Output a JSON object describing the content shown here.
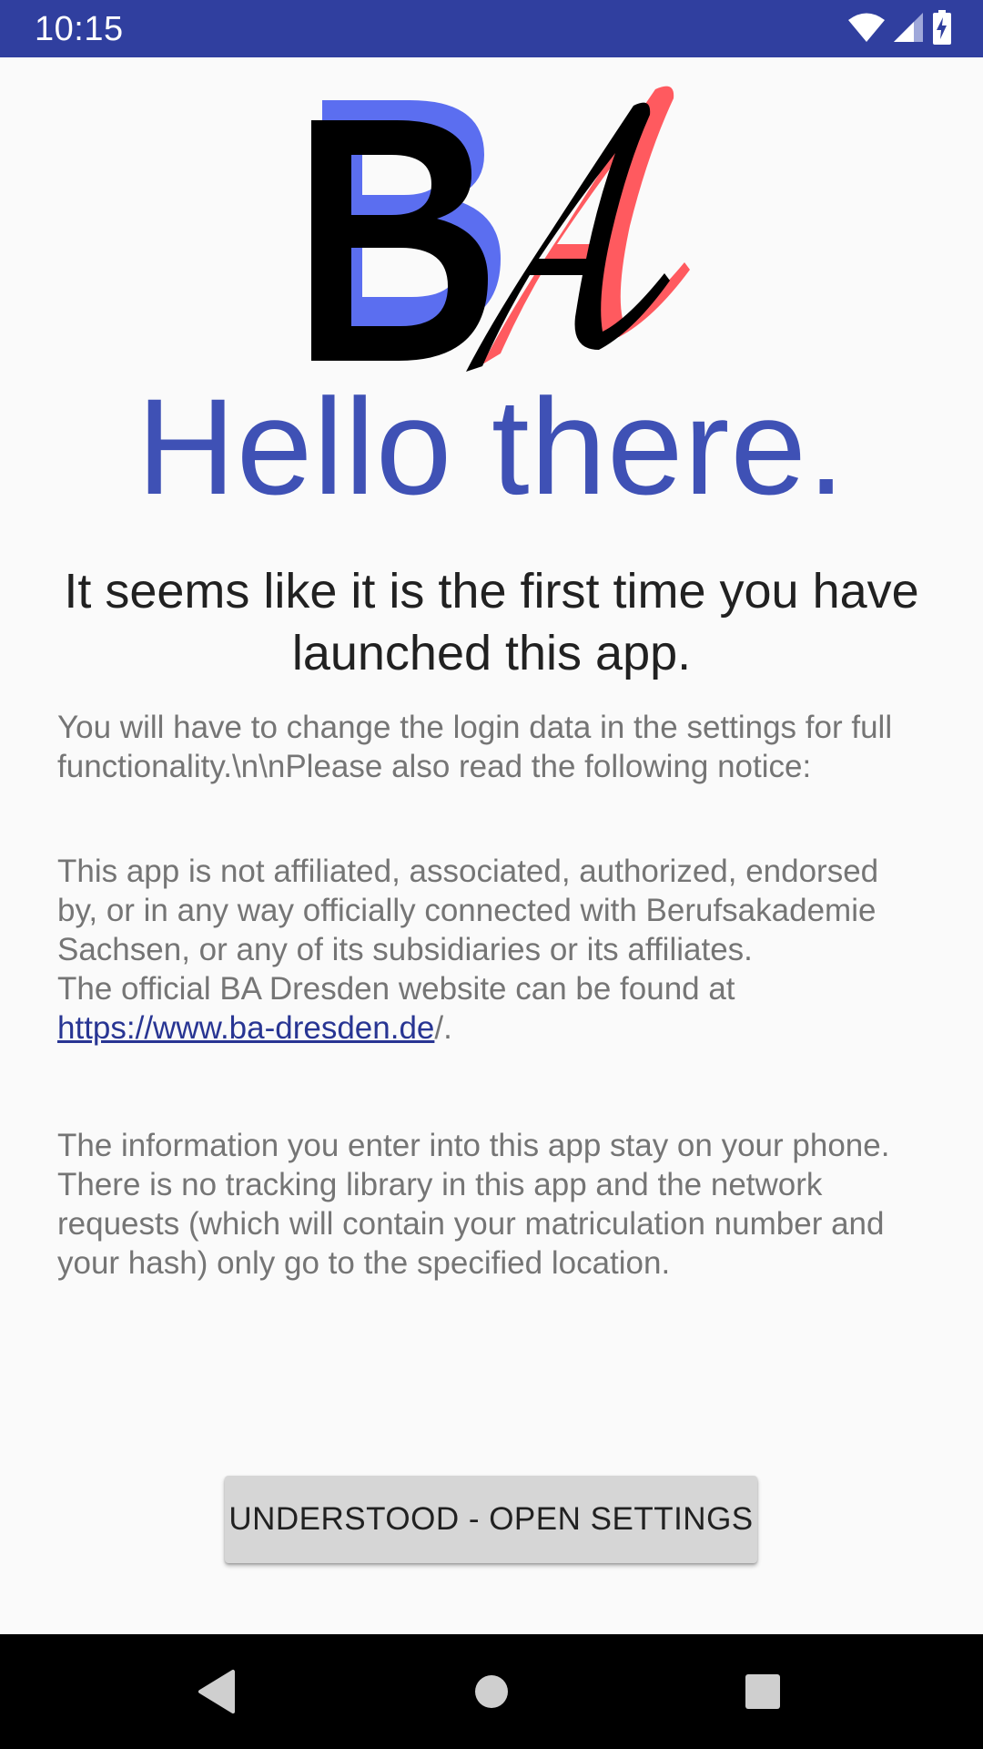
{
  "status_bar": {
    "time": "10:15",
    "icons": [
      "wifi-icon",
      "cell-signal-icon",
      "battery-charging-icon"
    ],
    "background": "#303f9f"
  },
  "logo": {
    "letters": "BA",
    "colors": {
      "blue": "#5b6ef0",
      "red": "#ff5a5f",
      "black": "#000000"
    }
  },
  "main": {
    "title": "Hello there.",
    "subtitle": "It seems like it is the first time you have launched this app.",
    "intro": "You will have to change the login data in the settings for full functionality.\\n\\nPlease also read the following notice:",
    "disclaimer": "This app is not affiliated, associated, authorized, endorsed by, or in any way officially connected with Berufsakademie Sachsen, or any of its subsidiaries or its affiliates.",
    "website_prefix": "The official BA Dresden website can be found at",
    "website_link": "https://www.ba-dresden.de",
    "website_suffix": "/.",
    "privacy": "The information you enter into this app stay on your phone. There is no tracking library in this app and the network requests (which will contain your matriculation number and your hash) only go to the specified location."
  },
  "actions": {
    "open_settings_label": "UNDERSTOOD - OPEN SETTINGS"
  },
  "nav_bar": {
    "icons": [
      "back-icon",
      "home-icon",
      "recents-icon"
    ]
  },
  "colors": {
    "accent": "#3f51b5",
    "link": "#283593",
    "body_text": "#757575",
    "background": "#fafafa"
  }
}
